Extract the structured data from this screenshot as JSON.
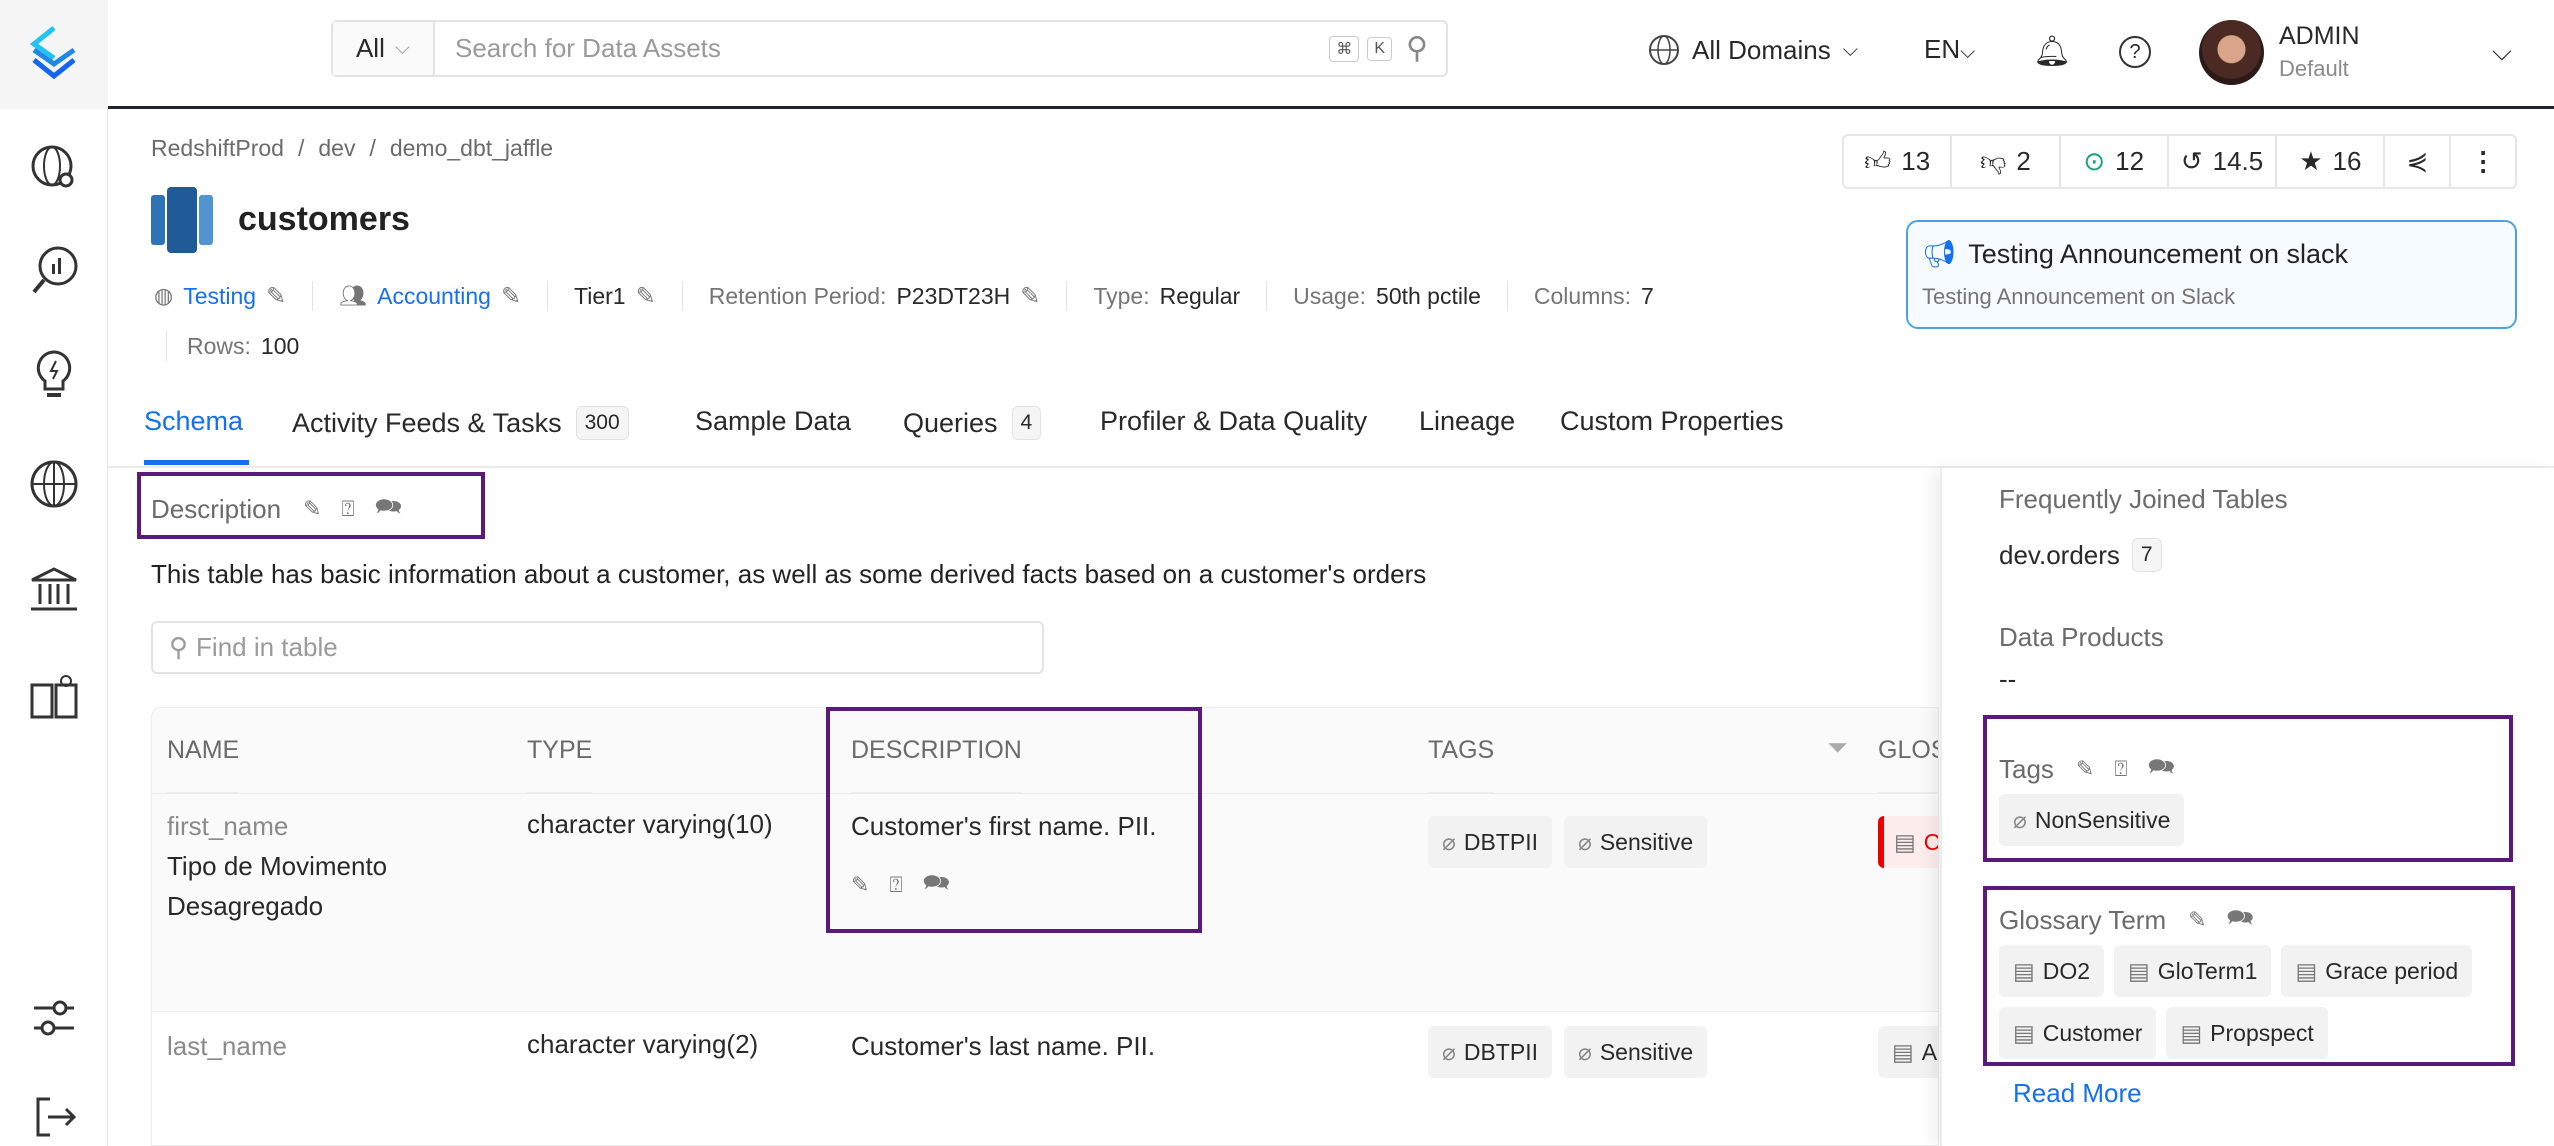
{
  "topbar": {
    "search_scope": "All",
    "search_placeholder": "Search for Data Assets",
    "kbd_cmd": "⌘",
    "kbd_k": "K",
    "domains": "All Domains",
    "language": "EN",
    "user_name": "ADMIN",
    "user_role": "Default"
  },
  "breadcrumb": [
    "RedshiftProd",
    "dev",
    "demo_dbt_jaffle"
  ],
  "entity": {
    "title": "customers",
    "domain": "Testing",
    "owner": "Accounting",
    "tier": "Tier1",
    "retention_label": "Retention Period:",
    "retention_value": "P23DT23H",
    "type_label": "Type:",
    "type_value": "Regular",
    "usage_label": "Usage:",
    "usage_value": "50th pctile",
    "columns_label": "Columns:",
    "columns_value": "7",
    "rows_label": "Rows:",
    "rows_value": "100"
  },
  "actions": {
    "upvotes": "13",
    "downvotes": "2",
    "followers": "12",
    "version": "14.5",
    "stars": "16"
  },
  "announcement": {
    "title": "Testing Announcement on slack",
    "body": "Testing Announcement on Slack"
  },
  "tabs": [
    {
      "label": "Schema",
      "active": true
    },
    {
      "label": "Activity Feeds & Tasks",
      "count": "300"
    },
    {
      "label": "Sample Data"
    },
    {
      "label": "Queries",
      "count": "4"
    },
    {
      "label": "Profiler & Data Quality"
    },
    {
      "label": "Lineage"
    },
    {
      "label": "Custom Properties"
    }
  ],
  "description": {
    "label": "Description",
    "text": "This table has basic information about a customer, as well as some derived facts based on a customer's orders"
  },
  "find_placeholder": "Find in table",
  "table": {
    "headers": [
      "NAME",
      "TYPE",
      "DESCRIPTION",
      "TAGS",
      "GLOS"
    ],
    "rows": [
      {
        "name": "first_name",
        "display_name": "Tipo de Movimento Desagregado",
        "type": "character varying(10)",
        "description": "Customer's first name. PII.",
        "tags": [
          "DBTPII",
          "Sensitive"
        ],
        "glossary": "C"
      },
      {
        "name": "last_name",
        "type": "character varying(2)",
        "description": "Customer's last name. PII.",
        "tags": [
          "DBTPII",
          "Sensitive"
        ],
        "glossary": "Ac"
      }
    ]
  },
  "right_panel": {
    "joined_title": "Frequently Joined Tables",
    "joined_table": "dev.orders",
    "joined_count": "7",
    "data_products_title": "Data Products",
    "data_products_value": "--",
    "tags_title": "Tags",
    "tags": [
      "NonSensitive"
    ],
    "glossary_title": "Glossary Term",
    "glossary": [
      "DO2",
      "GloTerm1",
      "Grace period",
      "Customer",
      "Propspect"
    ],
    "read_more": "Read More"
  },
  "colors": {
    "accent": "#1570ef",
    "highlight_box": "#5b1a7a",
    "announcement_border": "#4aa3df"
  }
}
